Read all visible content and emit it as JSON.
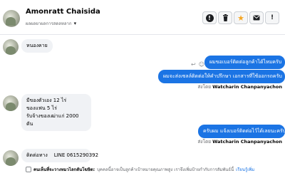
{
  "header": {
    "contact_name": "Amonratt Chaisida",
    "contact_subtitle": "ผลผลยาผลการสดลหลาก"
  },
  "messages": [
    {
      "direction": "in",
      "text": "หนองคาย"
    },
    {
      "direction": "out",
      "text": "ผมขอเบอร์ติดต่อลูกค้าได้ไหมครับ"
    },
    {
      "direction": "out",
      "text": "ผมจะส่งเซลล์ติดต่อให้คำปรึกษา เอกสารที่ใช้ออกรถครับ"
    },
    {
      "direction": "in",
      "lines": [
        "มีของตัวเอง 12 ไร่",
        "ของแฟน 5 ไร่",
        "รับจ้างของเฒ่าแก่ 2000 ตัน"
      ]
    },
    {
      "direction": "out",
      "text": "ครับผม แจ้งเบอร์ติดต่อไว้ได้เลยนะครับ"
    },
    {
      "direction": "in",
      "text": "ติดต่อทาง    LINE 0615290392"
    }
  ],
  "sent_by_prefix": "ส่งโดย",
  "sent_by_name": "Watcharin Chanpanyachon",
  "footer": {
    "label": "คนเห็นที่จะวางหมวไลกตันโฆษิต:",
    "text": "บุคคลนี้อาจเป็นลูกค้าเป้าหมายคุณภาพสูง เราจึงเพิ่มป้ายกำกับการสัมพันธ์นี้",
    "link": "เรียนรู้เพิ่ม"
  }
}
